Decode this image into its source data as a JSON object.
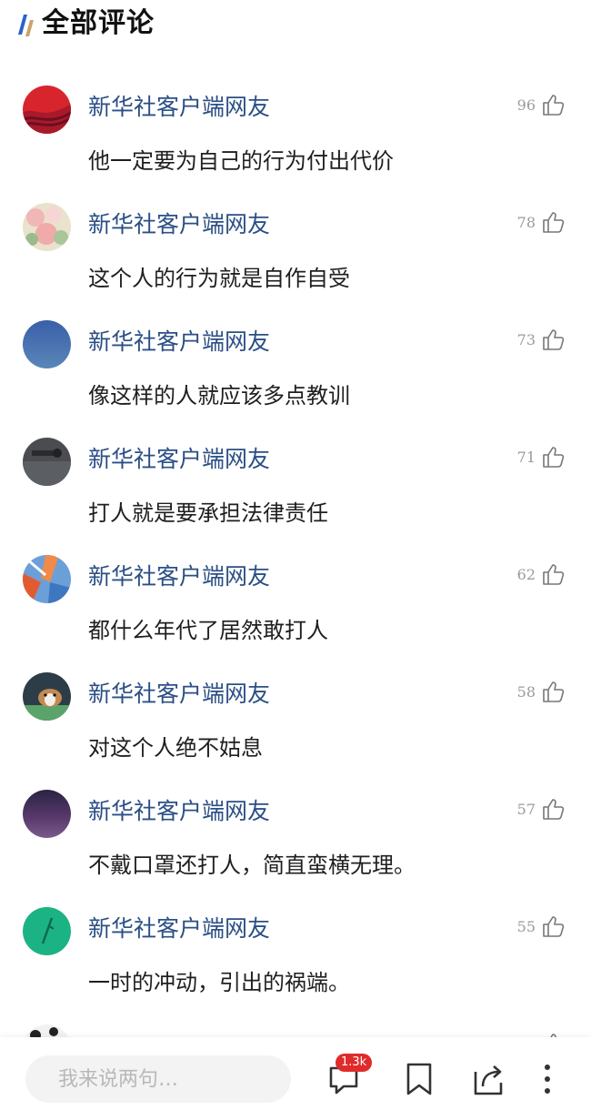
{
  "header": {
    "title": "全部评论"
  },
  "comments": [
    {
      "user": "新华社客户端网友",
      "likes": "96",
      "text": "他一定要为自己的行为付出代价"
    },
    {
      "user": "新华社客户端网友",
      "likes": "78",
      "text": "这个人的行为就是自作自受"
    },
    {
      "user": "新华社客户端网友",
      "likes": "73",
      "text": "像这样的人就应该多点教训"
    },
    {
      "user": "新华社客户端网友",
      "likes": "71",
      "text": "打人就是要承担法律责任"
    },
    {
      "user": "新华社客户端网友",
      "likes": "62",
      "text": "都什么年代了居然敢打人"
    },
    {
      "user": "新华社客户端网友",
      "likes": "58",
      "text": "对这个人绝不姑息"
    },
    {
      "user": "新华社客户端网友",
      "likes": "57",
      "text": "不戴口罩还打人，简直蛮横无理。"
    },
    {
      "user": "新华社客户端网友",
      "likes": "55",
      "text": "一时的冲动，引出的祸端。"
    }
  ],
  "bottom_bar": {
    "input_placeholder": "我来说两句…",
    "comment_count_badge": "1.3k",
    "icons": [
      "comment-icon",
      "bookmark-icon",
      "share-icon",
      "more-icon"
    ]
  },
  "colors": {
    "username": "#2b4f86",
    "badge": "#e02b2b",
    "logo_blue": "#2b63c9",
    "logo_gold": "#c9a46a"
  }
}
